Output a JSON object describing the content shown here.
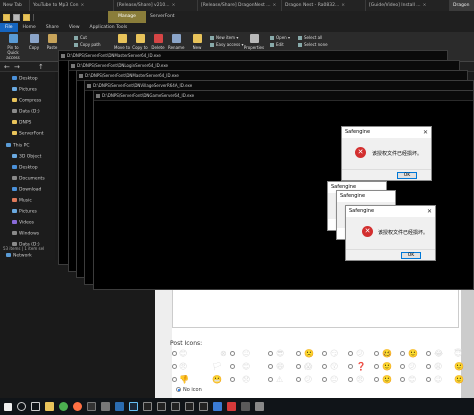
{
  "browser_tabs": [
    {
      "label": "New Tab",
      "active": false
    },
    {
      "label": "YouTube to Mp3 Con",
      "active": false
    },
    {
      "label": "[Release/Share] v210...",
      "active": false
    },
    {
      "label": "[Release/Share] DragonNest ...",
      "active": false
    },
    {
      "label": "Dragon Nest - Ra0832...",
      "active": false
    },
    {
      "label": "[Guide/Video] Install ...",
      "active": false
    },
    {
      "label": "Dragon",
      "active": true
    }
  ],
  "explorer": {
    "manage_label": "Manage",
    "path_label": "ServerFont",
    "ribbon_tabs": [
      "File",
      "Home",
      "Share",
      "View",
      "Application Tools"
    ],
    "ribbon": {
      "pin_label": "Pin to Quick access",
      "copy_label": "Copy",
      "paste_label": "Paste",
      "cut_label": "Cut",
      "copy_path_label": "Copy path",
      "move_to_label": "Move to",
      "copy_to_label": "Copy to",
      "delete_label": "Delete",
      "rename_label": "Rename",
      "new_folder_label": "New folder",
      "new_item_label": "New item",
      "easy_access_label": "Easy access",
      "properties_label": "Properties",
      "open_label": "Open",
      "edit_label": "Edit",
      "select_all_label": "Select all",
      "select_none_label": "Select none"
    },
    "tree_items": [
      {
        "label": "Desktop",
        "color": "#4a90d9"
      },
      {
        "label": "Pictures",
        "color": "#6aa9e0"
      },
      {
        "label": "Compress",
        "color": "#e8c35a"
      },
      {
        "label": "Data (D:)",
        "color": "#8a8a8a"
      },
      {
        "label": "DNPS",
        "color": "#e8c35a"
      },
      {
        "label": "ServerFont",
        "color": "#e8c35a"
      },
      {
        "label": "This PC",
        "color": "#5a9bd5"
      },
      {
        "label": "3D Object",
        "color": "#6aa9e0"
      },
      {
        "label": "Desktop",
        "color": "#4a90d9"
      },
      {
        "label": "Documents",
        "color": "#8a8a8a"
      },
      {
        "label": "Download",
        "color": "#4a90d9"
      },
      {
        "label": "Music",
        "color": "#e07a5a"
      },
      {
        "label": "Pictures",
        "color": "#6aa9e0"
      },
      {
        "label": "Videos",
        "color": "#8a6ad9"
      },
      {
        "label": "Windows",
        "color": "#8a8a8a"
      },
      {
        "label": "Data (D:)",
        "color": "#8a8a8a"
      },
      {
        "label": "Network",
        "color": "#5a9bd5"
      }
    ],
    "status": "53 items  |  1 item sel"
  },
  "console_windows": [
    {
      "title": "D:\\DNPS\\ServerFont\\DNMasterServer64_ID.exe"
    },
    {
      "title": "D:\\DNPS\\ServerFont\\DNLoginServer64_ID.exe"
    },
    {
      "title": "D:\\DNPS\\ServerFont\\DNMasterServer64_ID.exe"
    },
    {
      "title": "D:\\DNPS\\ServerFont\\DNVillageServerR64A_ID.exe"
    },
    {
      "title": "D:\\DNPS\\ServerFont\\DNGameServer64_ID.exe"
    }
  ],
  "dialogs": [
    {
      "title": "Safengine",
      "message": "该授权文件已经损坏。",
      "ok": "OK"
    },
    {
      "title": "Safengine",
      "message": "",
      "ok": ""
    },
    {
      "title": "Safengine",
      "message": "",
      "ok": ""
    },
    {
      "title": "Safengine",
      "message": "该授权文件已经损坏。",
      "ok": "OK"
    }
  ],
  "webpage": {
    "post_icons_label": "Post Icons:",
    "no_icon_label": "No icon",
    "emoji_rows": [
      [
        "😊",
        "⊗",
        "😐",
        "😎",
        "🙁",
        "😏",
        "😕",
        "🥴",
        "🙂",
        "😂",
        "😇"
      ],
      [
        "😠",
        "🏳",
        "😊",
        "😄",
        "😱",
        "😗",
        "❓",
        "🙂",
        "😕",
        "😩",
        "🙂"
      ],
      [
        "👎",
        "😬",
        "😞",
        "⚠",
        "😕",
        "😐",
        "😠",
        "🙂",
        "😊",
        "😉",
        "🙂"
      ]
    ]
  },
  "taskbar": {
    "icons": [
      "windows-start",
      "search",
      "task-view",
      "file-explorer",
      "chrome",
      "firefox",
      "terminal",
      "settings",
      "photos",
      "steam",
      "terminal",
      "terminal",
      "terminal",
      "terminal",
      "terminal",
      "app",
      "app",
      "app",
      "app"
    ],
    "colors": {
      "accent": "#1565c0",
      "manage": "#8a7d3a",
      "error": "#d32f2f"
    }
  }
}
